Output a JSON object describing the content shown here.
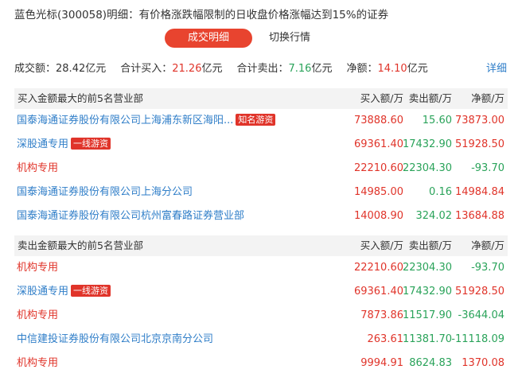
{
  "title": "蓝色光标(300058)明细：有价格涨跌幅限制的日收盘价格涨幅达到15%的证券",
  "tabs": {
    "active": "成交明细",
    "other": "切换行情"
  },
  "summary": {
    "turnover_label": "成交额：",
    "turnover_value": "28.42亿元",
    "buy_label": "合计买入：",
    "buy_value": "21.26",
    "buy_unit": "亿元",
    "sell_label": "合计卖出：",
    "sell_value": "7.16",
    "sell_unit": "亿元",
    "net_label": "净额：",
    "net_value": "14.10",
    "net_unit": "亿元"
  },
  "detail_link": "详细",
  "columns": {
    "buy": "买入额/万",
    "sell": "卖出额/万",
    "net": "净额/万"
  },
  "buy_section": {
    "header": "买入金额最大的前5名营业部",
    "rows": [
      {
        "name": "国泰海通证券股份有限公司上海浦东新区海阳...",
        "badge": "知名游资",
        "buy": "73888.60",
        "sell": "15.60",
        "net": "73873.00",
        "net_color": "red",
        "name_color": "blue"
      },
      {
        "name": "深股通专用",
        "badge": "一线游资",
        "buy": "69361.40",
        "sell": "17432.90",
        "net": "51928.50",
        "net_color": "red",
        "name_color": "blue"
      },
      {
        "name": "机构专用",
        "badge": "",
        "buy": "22210.60",
        "sell": "22304.30",
        "net": "-93.70",
        "net_color": "green",
        "name_color": "red"
      },
      {
        "name": "国泰海通证券股份有限公司上海分公司",
        "badge": "",
        "buy": "14985.00",
        "sell": "0.16",
        "net": "14984.84",
        "net_color": "red",
        "name_color": "blue"
      },
      {
        "name": "国泰海通证券股份有限公司杭州富春路证券营业部",
        "badge": "",
        "buy": "14008.90",
        "sell": "324.02",
        "net": "13684.88",
        "net_color": "red",
        "name_color": "blue"
      }
    ]
  },
  "sell_section": {
    "header": "卖出金额最大的前5名营业部",
    "rows": [
      {
        "name": "机构专用",
        "badge": "",
        "buy": "22210.60",
        "sell": "22304.30",
        "net": "-93.70",
        "net_color": "green",
        "name_color": "red"
      },
      {
        "name": "深股通专用",
        "badge": "一线游资",
        "buy": "69361.40",
        "sell": "17432.90",
        "net": "51928.50",
        "net_color": "red",
        "name_color": "blue"
      },
      {
        "name": "机构专用",
        "badge": "",
        "buy": "7873.86",
        "sell": "11517.90",
        "net": "-3644.04",
        "net_color": "green",
        "name_color": "red"
      },
      {
        "name": "中信建投证券股份有限公司北京京南分公司",
        "badge": "",
        "buy": "263.61",
        "sell": "11381.70",
        "net": "-11118.09",
        "net_color": "green",
        "name_color": "blue"
      },
      {
        "name": "机构专用",
        "badge": "",
        "buy": "9994.91",
        "sell": "8624.83",
        "net": "1370.08",
        "net_color": "red",
        "name_color": "red"
      }
    ]
  },
  "colors": {
    "accent": "#e8442f",
    "up": "#e0342a",
    "down": "#2aa35a",
    "link": "#2f7ec8"
  }
}
